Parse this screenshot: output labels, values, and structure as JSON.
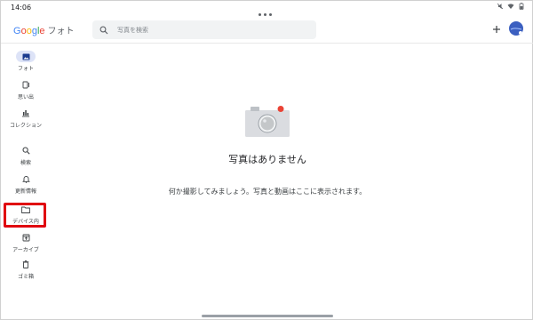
{
  "status": {
    "time": "14:06"
  },
  "app": {
    "logo_google": [
      "G",
      "o",
      "o",
      "g",
      "l",
      "e"
    ],
    "logo_product": "フォト"
  },
  "search": {
    "placeholder": "写真を検索"
  },
  "sidebar": {
    "items": [
      {
        "label": "フォト",
        "icon": "photo-icon",
        "active": true
      },
      {
        "label": "思い出",
        "icon": "memories-icon",
        "active": false
      },
      {
        "label": "コレクション",
        "icon": "collections-icon",
        "active": false
      },
      {
        "label": "検索",
        "icon": "search-icon",
        "active": false
      },
      {
        "label": "更新情報",
        "icon": "bell-icon",
        "active": false
      },
      {
        "label": "デバイス内",
        "icon": "folder-icon",
        "active": false
      },
      {
        "label": "アーカイブ",
        "icon": "archive-icon",
        "active": false
      },
      {
        "label": "ゴミ箱",
        "icon": "trash-icon",
        "active": false
      }
    ]
  },
  "main": {
    "empty_title": "写真はありません",
    "empty_desc": "何か撮影してみましょう。写真と動画はここに表示されます。"
  },
  "colors": {
    "highlight": "#e0000f",
    "active_pill": "#dde3f7",
    "camera_body": "#dadce0",
    "camera_accent": "#ea4335"
  }
}
